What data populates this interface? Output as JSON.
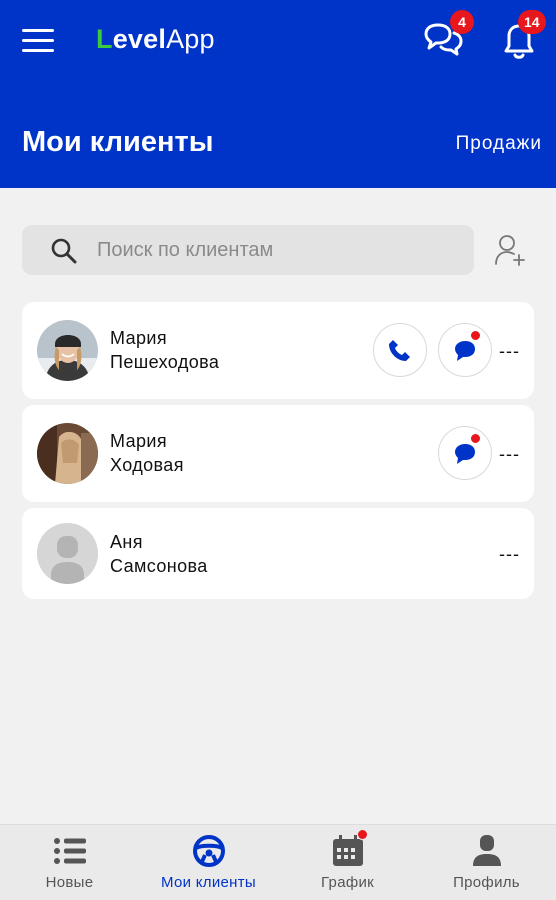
{
  "header": {
    "logo": {
      "part1": "L",
      "part2": "evel",
      "part3": "App"
    },
    "chat_badge": "4",
    "notifications_badge": "14",
    "title": "Мои клиенты",
    "sales_link": "Продажи"
  },
  "search": {
    "placeholder": "Поиск по клиентам",
    "value": ""
  },
  "clients": [
    {
      "first_name": "Мария",
      "last_name": "Пешеходова",
      "status": "---",
      "has_call": true,
      "has_chat": true,
      "chat_unread": true
    },
    {
      "first_name": "Мария",
      "last_name": "Ходовая",
      "status": "---",
      "has_call": false,
      "has_chat": true,
      "chat_unread": true
    },
    {
      "first_name": "Аня",
      "last_name": "Самсонова",
      "status": "---",
      "has_call": false,
      "has_chat": false,
      "chat_unread": false
    }
  ],
  "bottom_nav": {
    "items": [
      {
        "label": "Новые",
        "icon": "list-icon"
      },
      {
        "label": "Мои клиенты",
        "icon": "steering-wheel-icon",
        "active": true
      },
      {
        "label": "График",
        "icon": "calendar-icon",
        "has_dot": true
      },
      {
        "label": "Профиль",
        "icon": "person-icon"
      }
    ]
  },
  "colors": {
    "brand_blue": "#0033c7",
    "logo_green": "#3ccb3c",
    "badge_red": "#e8161d"
  }
}
